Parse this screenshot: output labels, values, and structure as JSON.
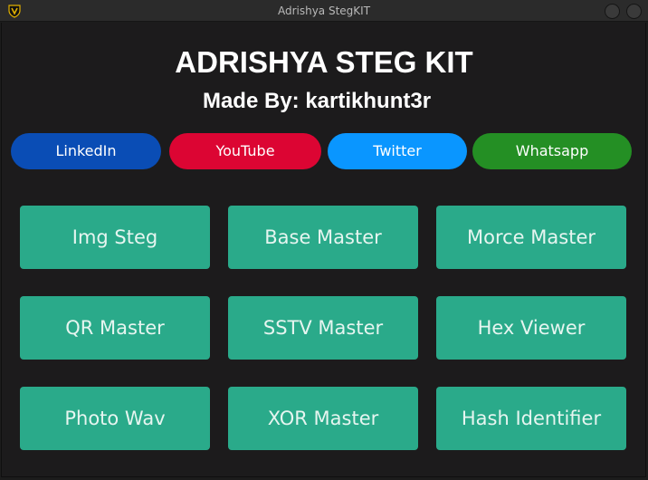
{
  "window": {
    "title": "Adrishya StegKIT",
    "app_icon": "shield-icon"
  },
  "header": {
    "title": "ADRISHYA STEG KIT",
    "subtitle": "Made By: kartikhunt3r"
  },
  "social_links": [
    {
      "label": "LinkedIn",
      "color": "#0a4db5"
    },
    {
      "label": "YouTube",
      "color": "#dc0533"
    },
    {
      "label": "Twitter",
      "color": "#0a96ff"
    },
    {
      "label": "Whatsapp",
      "color": "#248f24"
    }
  ],
  "tools": [
    {
      "label": "Img Steg"
    },
    {
      "label": "Base Master"
    },
    {
      "label": "Morce Master"
    },
    {
      "label": "QR Master"
    },
    {
      "label": "SSTV Master"
    },
    {
      "label": "Hex Viewer"
    },
    {
      "label": "Photo Wav"
    },
    {
      "label": "XOR Master"
    },
    {
      "label": "Hash Identifier"
    }
  ],
  "colors": {
    "background": "#1c1b1c",
    "tool_button": "#2aaa8a",
    "titlebar": "#2b2b2b"
  }
}
